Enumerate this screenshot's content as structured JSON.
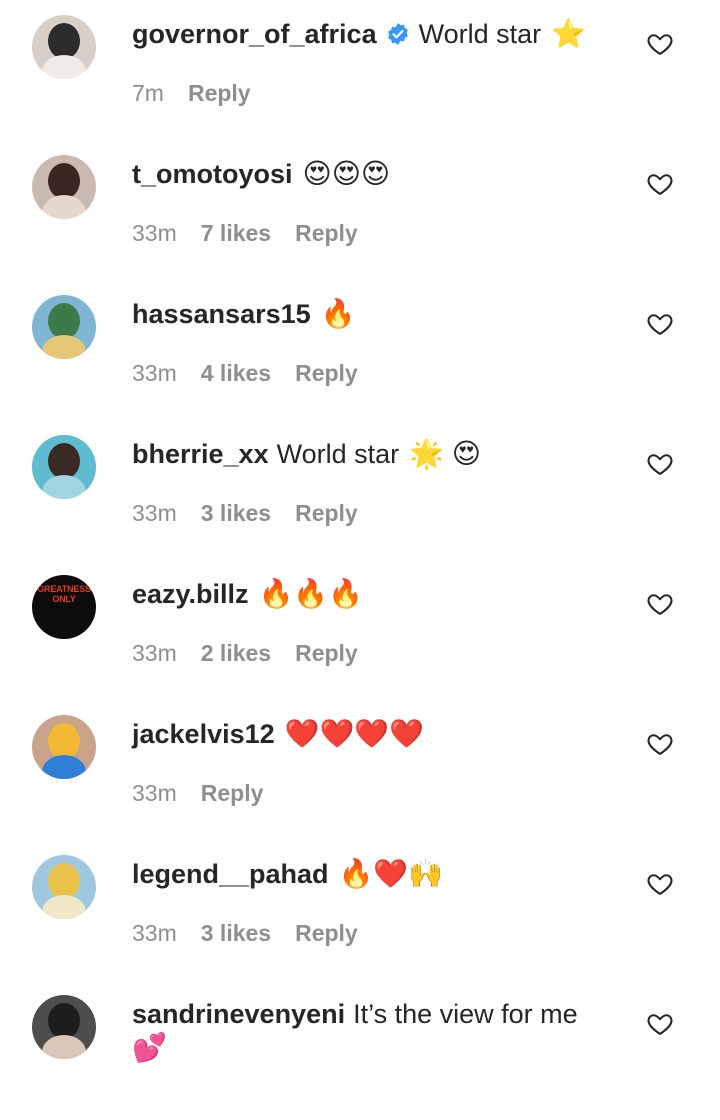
{
  "comments": [
    {
      "username": "governor_of_africa",
      "verified": true,
      "text": "World star",
      "emoji": "⭐",
      "time": "7m",
      "likes": "",
      "reply": "Reply",
      "avatar": {
        "bg": "#d8cfc9",
        "c1": "#2b2b2b",
        "c2": "#f1ebe7",
        "label": ""
      }
    },
    {
      "username": "t_omotoyosi",
      "verified": false,
      "text": "",
      "emoji": "😍😍😍",
      "time": "33m",
      "likes": "7 likes",
      "reply": "Reply",
      "avatar": {
        "bg": "#c9b9b0",
        "c1": "#3a2620",
        "c2": "#e6d7cf",
        "label": ""
      }
    },
    {
      "username": "hassansars15",
      "verified": false,
      "text": "",
      "emoji": "🔥",
      "time": "33m",
      "likes": "4 likes",
      "reply": "Reply",
      "avatar": {
        "bg": "#7fb6d4",
        "c1": "#3c7a4a",
        "c2": "#e3c676",
        "label": ""
      }
    },
    {
      "username": "bherrie_xx",
      "verified": false,
      "text": "World star",
      "emoji": "🌟 😍",
      "time": "33m",
      "likes": "3 likes",
      "reply": "Reply",
      "avatar": {
        "bg": "#5fbcd0",
        "c1": "#3a2a24",
        "c2": "#9fd6e2",
        "label": ""
      }
    },
    {
      "username": "eazy.billz",
      "verified": false,
      "text": "",
      "emoji": "🔥🔥🔥",
      "time": "33m",
      "likes": "2 likes",
      "reply": "Reply",
      "avatar": {
        "bg": "#0d0b0b",
        "c1": "#1d1515",
        "c2": "#2a1b1b",
        "label": "GREATNESS ONLY"
      }
    },
    {
      "username": "jackelvis12",
      "verified": false,
      "text": "",
      "emoji": "❤️❤️❤️❤️",
      "time": "33m",
      "likes": "",
      "reply": "Reply",
      "avatar": {
        "bg": "#c9a48a",
        "c1": "#f4b934",
        "c2": "#2f7fd8",
        "label": ""
      }
    },
    {
      "username": "legend__pahad",
      "verified": false,
      "text": "",
      "emoji": "🔥❤️🙌",
      "time": "33m",
      "likes": "3 likes",
      "reply": "Reply",
      "avatar": {
        "bg": "#9fc8e0",
        "c1": "#e8c24a",
        "c2": "#f0e8c8",
        "label": ""
      }
    },
    {
      "username": "sandrinevenyeni",
      "verified": false,
      "text": "It’s the view for me",
      "emoji": "",
      "time": "",
      "likes": "",
      "reply": "",
      "second_line": "💕",
      "avatar": {
        "bg": "#4d4d4d",
        "c1": "#1d1d1d",
        "c2": "#d9c7bb",
        "label": ""
      }
    }
  ],
  "colors": {
    "text": "#262626",
    "secondary": "#8e8e8e",
    "verified": "#3897f0"
  },
  "icons": {
    "heart": "heart-outline-icon",
    "verified": "verified-badge-icon"
  }
}
